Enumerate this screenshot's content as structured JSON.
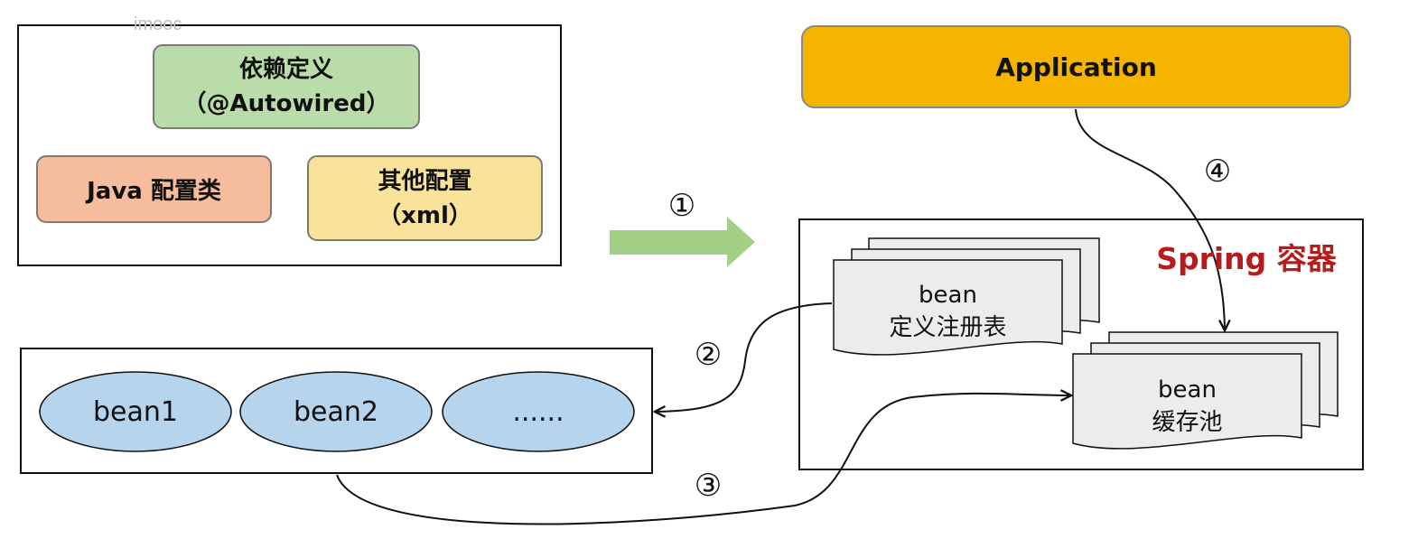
{
  "watermark": "imooc",
  "config_sources": {
    "dependency": {
      "line1": "依赖定义",
      "line2": "（@Autowired）"
    },
    "java_config": {
      "label": "Java 配置类"
    },
    "other_config": {
      "line1": "其他配置",
      "line2": "（xml）"
    }
  },
  "application": {
    "label": "Application"
  },
  "container": {
    "title": "Spring 容器"
  },
  "registry": {
    "line1": "bean",
    "line2": "定义注册表"
  },
  "cache_pool": {
    "line1": "bean",
    "line2": "缓存池"
  },
  "beans": [
    {
      "label": "bean1"
    },
    {
      "label": "bean2"
    },
    {
      "label": "......"
    }
  ],
  "steps": {
    "s1": "①",
    "s2": "②",
    "s3": "③",
    "s4": "④"
  },
  "colors": {
    "dependency_fill": "#b9dcaa",
    "java_fill": "#f5bd9d",
    "other_fill": "#f9e39a",
    "application_fill": "#f4b400",
    "bean_fill": "#b7d4ed",
    "arrow_green": "#a3cf87",
    "container_title": "#b71c1c",
    "doc_fill": "#ececec"
  }
}
